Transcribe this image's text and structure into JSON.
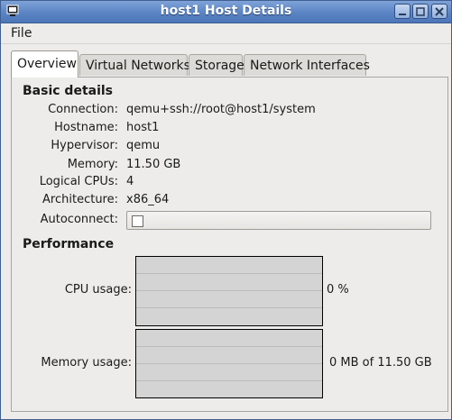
{
  "window": {
    "title": "host1 Host Details"
  },
  "menu": {
    "file": "File"
  },
  "tabs": [
    {
      "label": "Overview",
      "active": true
    },
    {
      "label": "Virtual Networks",
      "active": false
    },
    {
      "label": "Storage",
      "active": false
    },
    {
      "label": "Network Interfaces",
      "active": false
    }
  ],
  "basic": {
    "heading": "Basic details",
    "connection_label": "Connection:",
    "connection": "qemu+ssh://root@host1/system",
    "hostname_label": "Hostname:",
    "hostname": "host1",
    "hypervisor_label": "Hypervisor:",
    "hypervisor": "qemu",
    "memory_label": "Memory:",
    "memory": "11.50 GB",
    "cpus_label": "Logical CPUs:",
    "cpus": "4",
    "arch_label": "Architecture:",
    "arch": "x86_64",
    "autoconnect_label": "Autoconnect:",
    "autoconnect_checked": false
  },
  "performance": {
    "heading": "Performance",
    "cpu_label": "CPU usage:",
    "cpu_value": "0 %",
    "mem_label": "Memory usage:",
    "mem_value": "0 MB of 11.50 GB"
  }
}
